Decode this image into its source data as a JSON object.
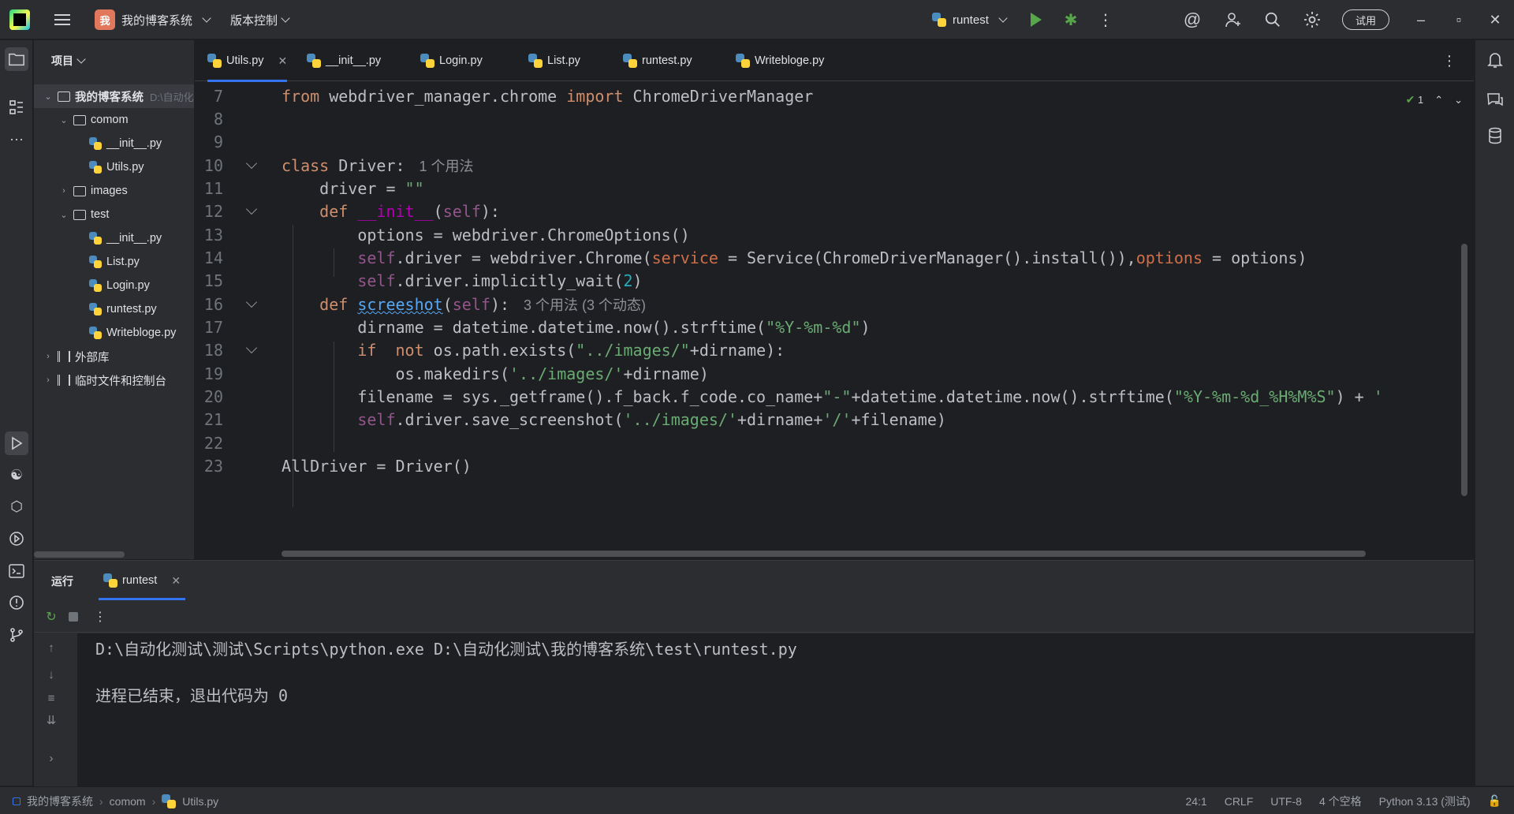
{
  "titlebar": {
    "project_badge": "我",
    "project_name": "我的博客系统",
    "vcs_label": "版本控制",
    "run_config": "runtest",
    "trial_label": "试用"
  },
  "project_panel": {
    "title": "项目",
    "tree": [
      {
        "label": "我的博客系统",
        "hint": "D:\\自动化",
        "type": "root"
      },
      {
        "label": "comom",
        "type": "folder"
      },
      {
        "label": "__init__.py",
        "type": "py"
      },
      {
        "label": "Utils.py",
        "type": "py"
      },
      {
        "label": "images",
        "type": "folder"
      },
      {
        "label": "test",
        "type": "folder"
      },
      {
        "label": "__init__.py",
        "type": "py"
      },
      {
        "label": "List.py",
        "type": "py"
      },
      {
        "label": "Login.py",
        "type": "py"
      },
      {
        "label": "runtest.py",
        "type": "py"
      },
      {
        "label": "Writebloge.py",
        "type": "py"
      },
      {
        "label": "外部库",
        "type": "lib"
      },
      {
        "label": "临时文件和控制台",
        "type": "scratch"
      }
    ]
  },
  "editor": {
    "tabs": [
      "Utils.py",
      "__init__.py",
      "Login.py",
      "List.py",
      "runtest.py",
      "Writebloge.py"
    ],
    "active_tab": "Utils.py",
    "inspection_count": "1",
    "line_numbers": [
      "7",
      "8",
      "9",
      "10",
      "11",
      "12",
      "13",
      "14",
      "15",
      "16",
      "17",
      "18",
      "19",
      "20",
      "21",
      "22",
      "23"
    ],
    "hints": {
      "class_usages": "1 个用法",
      "method_usages": "3 个用法 (3 个动态)"
    }
  },
  "run_panel": {
    "title": "运行",
    "tab": "runtest",
    "console": [
      "D:\\自动化测试\\测试\\Scripts\\python.exe D:\\自动化测试\\我的博客系统\\test\\runtest.py",
      "",
      "进程已结束，退出代码为 0"
    ]
  },
  "statusbar": {
    "breadcrumb": [
      "我的博客系统",
      "comom",
      "Utils.py"
    ],
    "cursor": "24:1",
    "line_sep": "CRLF",
    "encoding": "UTF-8",
    "indent": "4 个空格",
    "interpreter": "Python 3.13 (测试)"
  },
  "colors": {
    "accent": "#3574f0",
    "keyword": "#cf8e6d",
    "string": "#6aab73",
    "number": "#2aacb8",
    "self": "#94558d",
    "run_green": "#57a64a"
  }
}
